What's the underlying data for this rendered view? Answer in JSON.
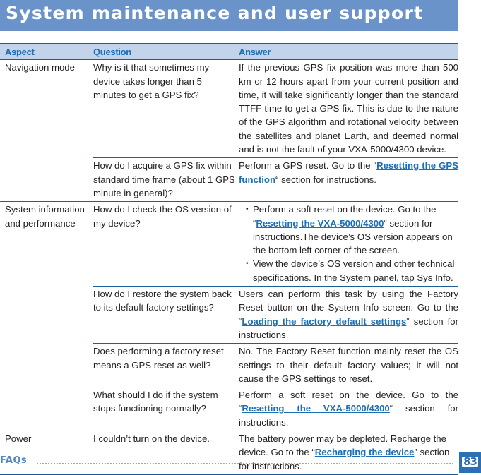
{
  "header": {
    "title": "System maintenance and user support"
  },
  "table": {
    "columns": {
      "aspect": "Aspect",
      "question": "Question",
      "answer": "Answer"
    },
    "rows": [
      {
        "aspect": "Navigation mode",
        "question": "Why is it that sometimes my device takes longer than 5 minutes to get a GPS fix?",
        "answer": "If the previous GPS fix position was more than 500 km or 12 hours apart from your current position and time, it will take significantly longer than the standard TTFF time to get a GPS fix. This is due to the nature of the GPS algorithm and rotational velocity between the satellites and planet Earth, and deemed normal and is not the fault of your VXA-5000/4300 device."
      },
      {
        "aspect": "",
        "question": "How do I acquire a GPS fix within standard time frame (about 1 GPS minute in general)?",
        "answer_pre": "Perform a GPS reset. Go to the “",
        "answer_link": "Resetting the GPS function",
        "answer_post": "“ section for instructions."
      },
      {
        "aspect": "System information and performance",
        "question": "How do I check the OS version of my device?",
        "bullets": [
          {
            "pre": "Perform a soft reset on the device. Go to the “",
            "link": "Resetting the VXA-5000/4300",
            "post": "“ section for instructions.The device’s OS version appears on the bottom left corner of the screen."
          },
          {
            "text": "View the device’s OS version and other technical specifications. In the System panel, tap Sys Info."
          }
        ]
      },
      {
        "aspect": "",
        "question": "How do I restore the system back to its default factory settings?",
        "answer_pre": "Users can perform this task by using the Factory Reset button on the System Info screen. Go to the “",
        "answer_link": "Loading the factory default settings",
        "answer_post": "“ section for instructions."
      },
      {
        "aspect": "",
        "question": "Does performing a factory reset means a GPS reset as well?",
        "answer": "No. The Factory Reset function mainly reset the OS settings to their default factory values; it will not cause the GPS settings to reset."
      },
      {
        "aspect": "",
        "question": "What should I do if the system stops functioning normally?",
        "answer_pre": "Perform a soft reset on the device. Go to the “",
        "answer_link": "Resetting the VXA-5000/4300",
        "answer_post": "“ section for instructions."
      },
      {
        "aspect": "Power",
        "question": "I couldn’t turn on the device.",
        "answer_pre": "The battery power may be depleted. Recharge the device. Go to the “",
        "answer_link": "Recharging the device",
        "answer_post": "” section for instructions."
      }
    ]
  },
  "footer": {
    "section": "FAQs",
    "page": "83"
  },
  "colors": {
    "band": "#6a94c9",
    "header_row": "#c3d3ea",
    "accent": "#1b6fb5",
    "rule": "#1f5d99"
  }
}
